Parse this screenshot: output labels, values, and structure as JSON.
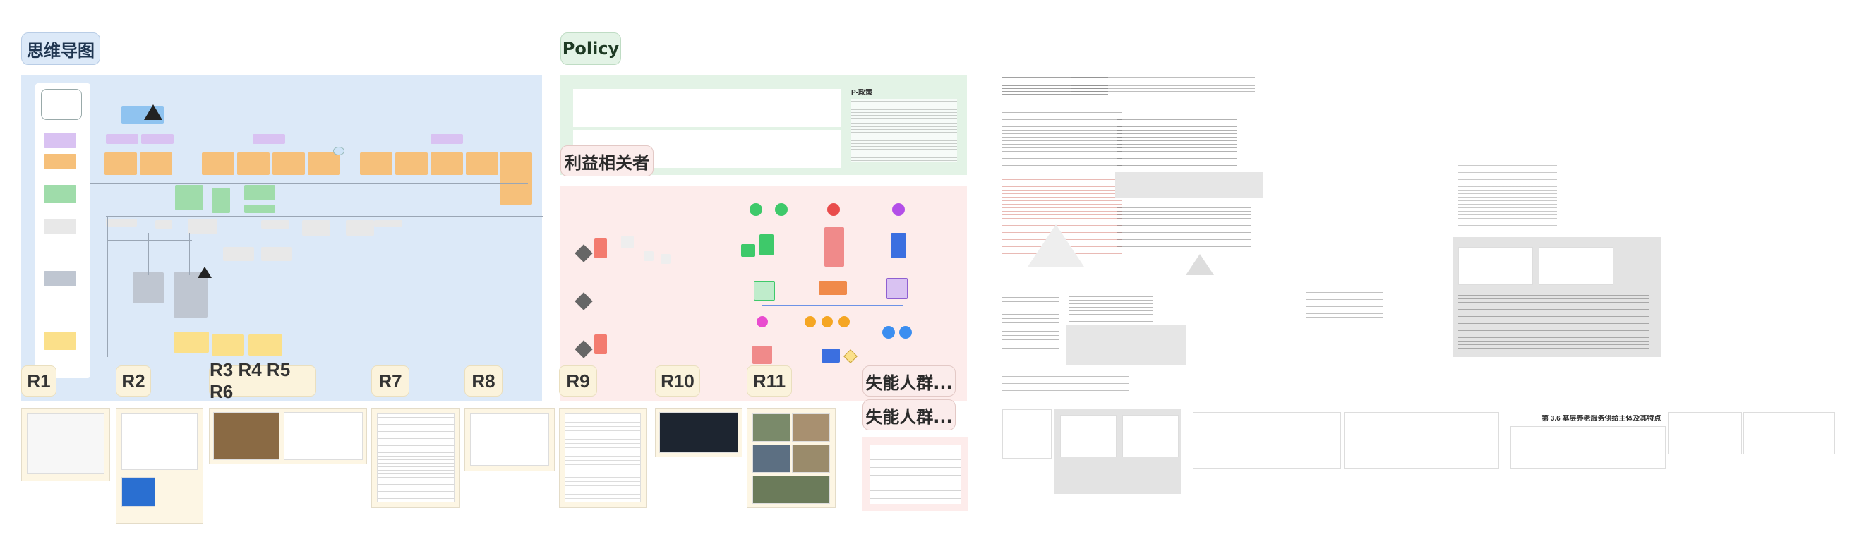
{
  "frames": {
    "mindmap": {
      "label": "思维导图"
    },
    "policy": {
      "label": "Policy"
    },
    "stakeholders": {
      "label": "利益相关者"
    },
    "disabled1": {
      "label": "失能人群..."
    },
    "disabled2": {
      "label": "失能人群..."
    }
  },
  "tags": [
    "R1",
    "R2",
    "R3 R4 R5 R6",
    "R7",
    "R8",
    "R9",
    "R10",
    "R11"
  ],
  "policy_title": "P-政策",
  "doc_title": "第 3.6  基层养老服务供给主体及其特点",
  "colors": {
    "mindmap_bg": "#dce9f8",
    "policy_bg": "#e3f3e6",
    "stake_bg": "#fde9e6",
    "tag_bg": "#fbf3dc",
    "node_orange": "#f6c07a",
    "node_purple": "#d9c2f2",
    "node_green": "#9fdcaa",
    "node_gray": "#bfc6d1",
    "node_yellow": "#fbe08a"
  }
}
